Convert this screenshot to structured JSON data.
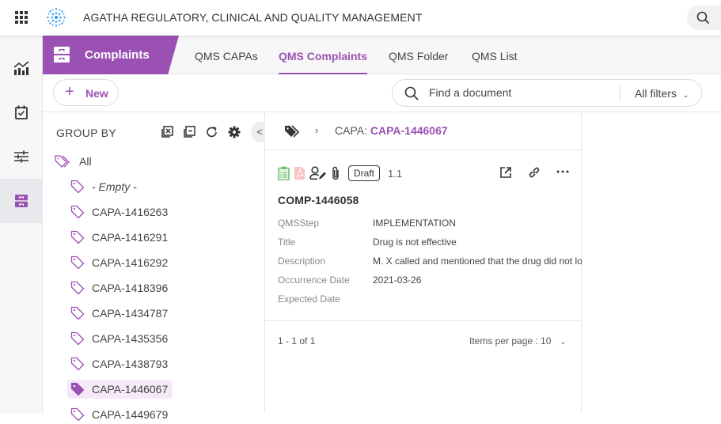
{
  "header": {
    "app_title": "AGATHA REGULATORY, CLINICAL AND QUALITY MANAGEMENT",
    "apps_icon": "grid-icon",
    "logo_icon": "agatha-logo-icon",
    "search_icon": "search-icon"
  },
  "leftnav": {
    "items": [
      {
        "name": "dashboard",
        "icon": "chart-icon",
        "active": false
      },
      {
        "name": "tasks",
        "icon": "calendar-check-icon",
        "active": false
      },
      {
        "name": "settings",
        "icon": "sliders-icon",
        "active": false
      },
      {
        "name": "complaints",
        "icon": "cabinet-icon",
        "active": true
      }
    ]
  },
  "module": {
    "label": "Complaints",
    "icon": "cabinet-icon"
  },
  "tabs": [
    {
      "label": "QMS CAPAs",
      "active": false
    },
    {
      "label": "QMS Complaints",
      "active": true
    },
    {
      "label": "QMS Folder",
      "active": false
    },
    {
      "label": "QMS List",
      "active": false
    }
  ],
  "toolbar": {
    "new_label": "New",
    "search_placeholder": "Find a document",
    "search_value": "",
    "filters_label": "All filters"
  },
  "group_panel": {
    "title": "GROUP BY",
    "actions": [
      "clear-selection-icon",
      "collapse-all-icon",
      "refresh-icon",
      "settings-icon"
    ],
    "collapse_label": "<",
    "items": [
      {
        "label": "All",
        "type": "all"
      },
      {
        "label": "- Empty -",
        "type": "empty"
      },
      {
        "label": "CAPA-1416263"
      },
      {
        "label": "CAPA-1416291"
      },
      {
        "label": "CAPA-1416292"
      },
      {
        "label": "CAPA-1418396"
      },
      {
        "label": "CAPA-1434787"
      },
      {
        "label": "CAPA-1435356"
      },
      {
        "label": "CAPA-1438793"
      },
      {
        "label": "CAPA-1446067",
        "selected": true
      },
      {
        "label": "CAPA-1449679"
      }
    ]
  },
  "detail": {
    "breadcrumb": {
      "separator": "›",
      "label": "CAPA: ",
      "value": "CAPA-1446067"
    },
    "card": {
      "status": "Draft",
      "version": "1.1",
      "doc_id": "COMP-1446058",
      "properties": [
        {
          "label": "QMSStep",
          "value": "IMPLEMENTATION"
        },
        {
          "label": "Title",
          "value": "Drug is not effective"
        },
        {
          "label": "Description",
          "value": "M. X called and mentioned that the drug did not lower"
        },
        {
          "label": "Occurrence Date",
          "value": "2021-03-26"
        },
        {
          "label": "Expected Date",
          "value": ""
        }
      ]
    },
    "pager": {
      "range": "1 - 1 of 1",
      "items_per_page": "Items per page : 10"
    }
  },
  "colors": {
    "accent": "#9b51b3",
    "selected_bg": "#f5e9f7",
    "logo": "#3a9ff0",
    "form_icon": "#5cb85c",
    "pdf_icon": "#f4a3a3"
  }
}
